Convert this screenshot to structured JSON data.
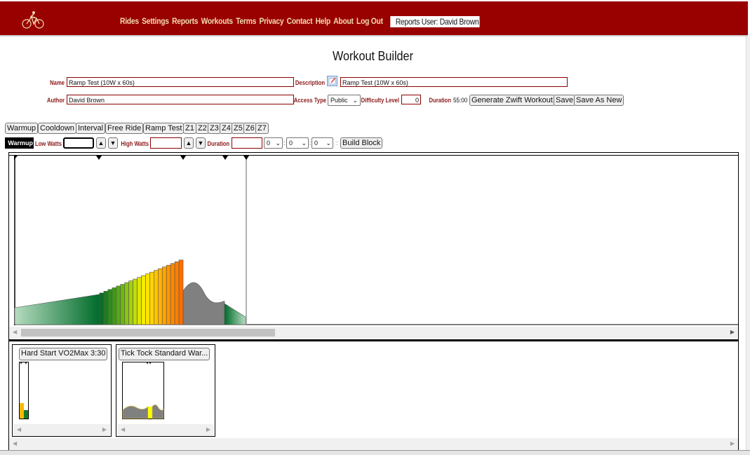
{
  "header": {
    "logo_icon": "cyclist-icon",
    "nav": [
      "Rides",
      "Settings",
      "Reports",
      "Workouts",
      "Terms",
      "Privacy",
      "Contact",
      "Help",
      "About",
      "Log Out"
    ],
    "user_badge": "Reports User: David Brown"
  },
  "page": {
    "title": "Workout Builder"
  },
  "form": {
    "name_label": "Name",
    "name_value": "Ramp Test (10W x 60s)",
    "description_label": "Description",
    "description_value": "Ramp Test (10W x 60s)",
    "description_icon": "edit-note-icon",
    "author_label": "Author",
    "author_value": "David Brown",
    "access_label": "Access Type",
    "access_value": "Public",
    "difficulty_label": "Difficulty Level",
    "difficulty_value": "0",
    "duration_label": "Duration",
    "duration_value": "55:00",
    "generate_button": "Generate Zwift Workout",
    "save_button": "Save",
    "save_as_new_button": "Save As New"
  },
  "block_types": [
    "Warmup",
    "Cooldown",
    "Interval",
    "Free Ride",
    "Ramp Test",
    "Z1",
    "Z2",
    "Z3",
    "Z4",
    "Z5",
    "Z6",
    "Z7"
  ],
  "builder": {
    "selected_type": "Warmup",
    "low_watts_label": "Low Watts",
    "low_watts_value": "",
    "high_watts_label": "High Watts",
    "high_watts_value": "",
    "duration_label": "Duration",
    "duration_value": "",
    "hours": "0",
    "minutes": "0",
    "seconds": "0",
    "separator": "::",
    "build_button": "Build Block"
  },
  "workout_chart": {
    "segments": [
      {
        "type": "warmup",
        "low": 0.25,
        "high": 0.45,
        "color_from": "#a8d5b5",
        "color_to": "#006b2a"
      },
      {
        "type": "ramp",
        "steps": 20,
        "low": 0.47,
        "high": 0.96
      },
      {
        "type": "freeride",
        "color": "#808080"
      },
      {
        "type": "cooldown",
        "low": 0.48,
        "high": 0.12,
        "color_from": "#006b2a",
        "color_to": "#a8d5b5"
      }
    ],
    "markers": 5
  },
  "library": [
    {
      "title": "Hard Start VO2Max 3:30"
    },
    {
      "title": "Tick Tock Standard War..."
    }
  ]
}
